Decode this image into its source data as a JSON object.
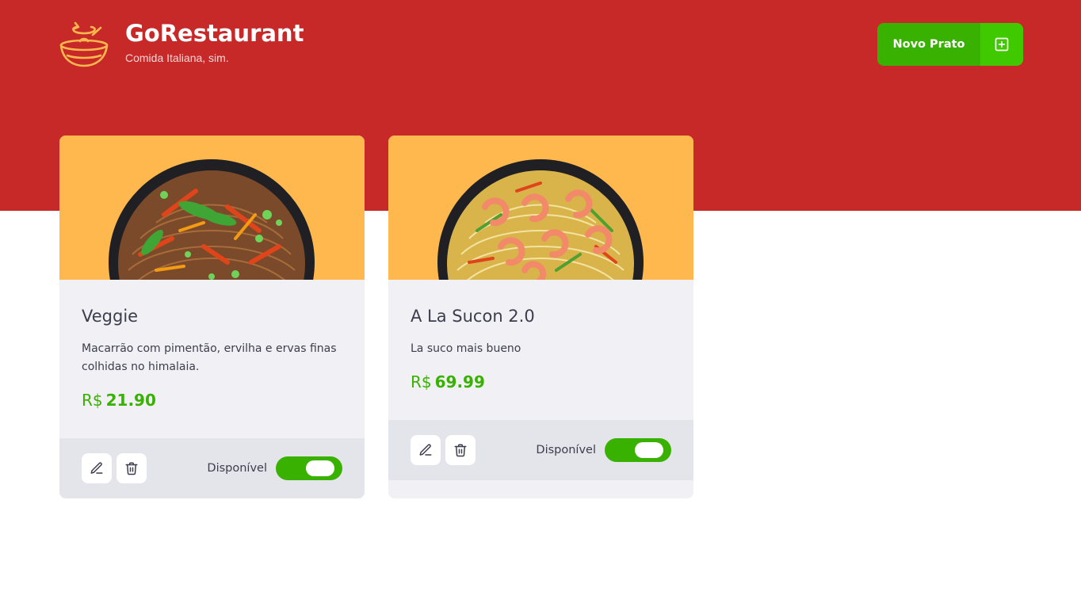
{
  "header": {
    "title": "GoRestaurant",
    "subtitle": "Comida Italiana, sim.",
    "new_dish_label": "Novo Prato",
    "colors": {
      "background": "#c72828",
      "logo": "#ffb84d",
      "button": "#39b100",
      "button_icon_bg": "#41c900"
    }
  },
  "dishes": [
    {
      "name": "Veggie",
      "description": "Macarrão com pimentão, ervilha e ervas finas colhidas no himalaia.",
      "price_currency": "R$",
      "price_value": "21.90",
      "availability_label": "Disponível",
      "available": true,
      "image_icon": "veggie-noodles-bowl-image"
    },
    {
      "name": "A La Sucon 2.0",
      "description": "La suco mais bueno",
      "price_currency": "R$",
      "price_value": "69.99",
      "availability_label": "Disponível",
      "available": true,
      "image_icon": "shrimp-noodles-bowl-image"
    }
  ],
  "icons": {
    "logo": "bowl-icon",
    "new_dish": "plus-square-icon",
    "edit": "pencil-icon",
    "delete": "trash-icon"
  },
  "colors": {
    "card_bg": "#f0f0f5",
    "card_footer_bg": "#e4e4eb",
    "card_image_bg": "#ffb84d",
    "price": "#39b100",
    "text": "#3d3d4d"
  }
}
